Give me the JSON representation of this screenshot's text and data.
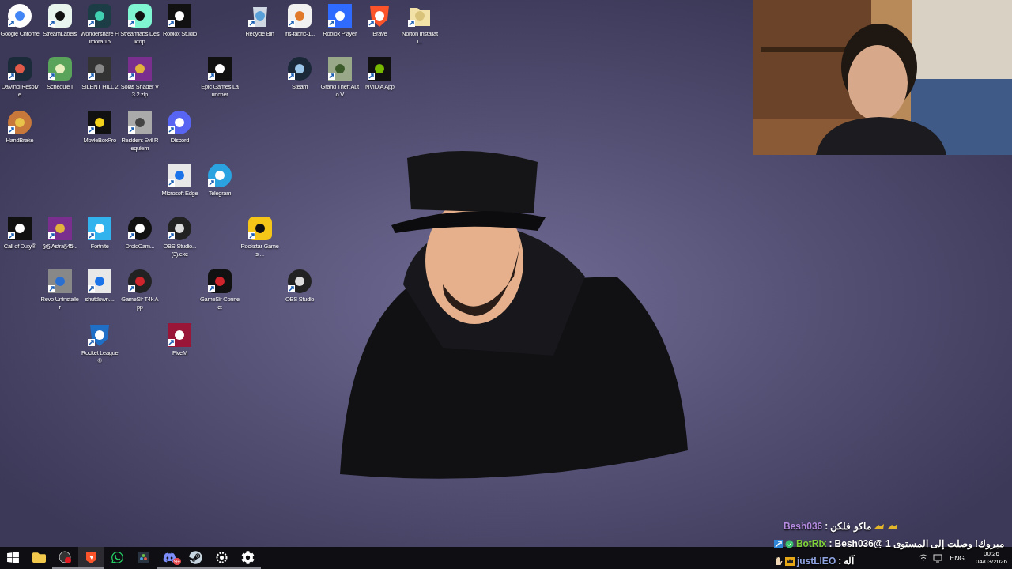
{
  "desktop": {
    "shortcuts": [
      {
        "label": "Google Chrome"
      },
      {
        "label": "StreamLabels"
      },
      {
        "label": "Wondershare Filmora 15"
      },
      {
        "label": "Streamlabs Desktop"
      },
      {
        "label": "Roblox Studio"
      },
      {
        "label": "Recycle Bin"
      },
      {
        "label": "iris-fabric-1..."
      },
      {
        "label": "Roblox Player"
      },
      {
        "label": "Brave"
      },
      {
        "label": "Norton Installati..."
      },
      {
        "label": "DaVinci Resolve"
      },
      {
        "label": "Schedule I"
      },
      {
        "label": "SILENT HILL 2"
      },
      {
        "label": "Solas Shader V3.2.zip"
      },
      {
        "label": "Epic Games Launcher"
      },
      {
        "label": "Steam"
      },
      {
        "label": "Grand Theft Auto V"
      },
      {
        "label": "NVIDIA App"
      },
      {
        "label": "HandBrake"
      },
      {
        "label": "MovieBoxPro"
      },
      {
        "label": "Resident Evil Requiem"
      },
      {
        "label": "Discord"
      },
      {
        "label": "Microsoft Edge"
      },
      {
        "label": "Telegram"
      },
      {
        "label": "Call of Duty®"
      },
      {
        "label": "§r§lAstra§45..."
      },
      {
        "label": "Fortnite"
      },
      {
        "label": "DroidCam..."
      },
      {
        "label": "OBS-Studio... (3).exe"
      },
      {
        "label": "Rockstar Games ..."
      },
      {
        "label": "Revo Uninstaller"
      },
      {
        "label": "shutdown...."
      },
      {
        "label": "GameSir T4k App"
      },
      {
        "label": "GameSir Connect"
      },
      {
        "label": "OBS Studio"
      },
      {
        "label": "Rocket League®"
      },
      {
        "label": "FiveM"
      }
    ]
  },
  "chat": [
    {
      "user": "Besh036",
      "color": "#b48be0",
      "separator": ":",
      "text": "ماكو فلكن"
    },
    {
      "user": "BotRix",
      "color": "#7fd03a",
      "separator": ":",
      "text": "مبروك! وصلت إلى المستوى 1 @Besh036"
    },
    {
      "user": "justLIEO",
      "color": "#8fa3e0",
      "separator": ":",
      "text": "آلة"
    }
  ],
  "taskbar": {
    "apps": [
      {
        "selected": false,
        "running": false
      },
      {
        "selected": false,
        "running": false
      },
      {
        "selected": false,
        "running": true
      },
      {
        "selected": true,
        "running": true
      },
      {
        "selected": false,
        "running": false
      },
      {
        "selected": false,
        "running": false
      },
      {
        "selected": false,
        "running": true,
        "badge": "9+"
      },
      {
        "selected": false,
        "running": true
      },
      {
        "selected": false,
        "running": true
      },
      {
        "selected": false,
        "running": true
      }
    ],
    "tray": {
      "language": "ENG",
      "time": "00:26",
      "date": "04/03/2026"
    }
  }
}
